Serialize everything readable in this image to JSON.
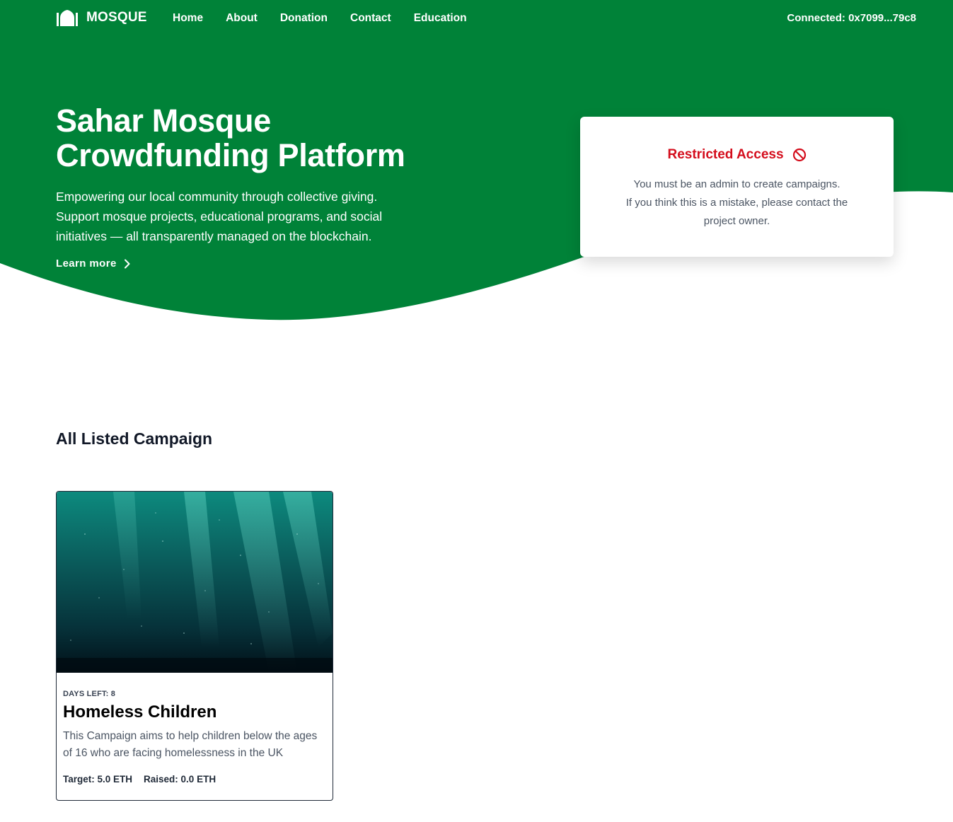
{
  "colors": {
    "brand_green": "#008238",
    "danger_red": "#d40d1c",
    "text_muted": "#4b5563"
  },
  "nav": {
    "brand_icon": "mosque-icon",
    "brand_name": "MOSQUE",
    "links": [
      "Home",
      "About",
      "Donation",
      "Contact",
      "Education"
    ],
    "wallet": "Connected: 0x7099...79c8"
  },
  "hero": {
    "title_line1": "Sahar Mosque",
    "title_line2": "Crowdfunding Platform",
    "description": "Empowering our local community through collective giving. Support mosque projects, educational programs, and social initiatives — all transparently managed on the blockchain.",
    "learn_more": "Learn more",
    "learn_more_icon": "chevron-right-icon"
  },
  "restricted": {
    "title": "Restricted Access",
    "icon": "ban-icon",
    "line1": "You must be an admin to create campaigns.",
    "line2": "If you think this is a mistake, please contact the project owner."
  },
  "campaigns": {
    "section_title": "All Listed Campaign",
    "items": [
      {
        "days_left": "DAYS LEFT: 8",
        "title": "Homeless Children",
        "description": "This Campaign aims to help children below the ages of 16 who are facing homelessness in the UK",
        "target": "Target: 5.0 ETH",
        "raised": "Raised: 0.0 ETH"
      }
    ]
  }
}
